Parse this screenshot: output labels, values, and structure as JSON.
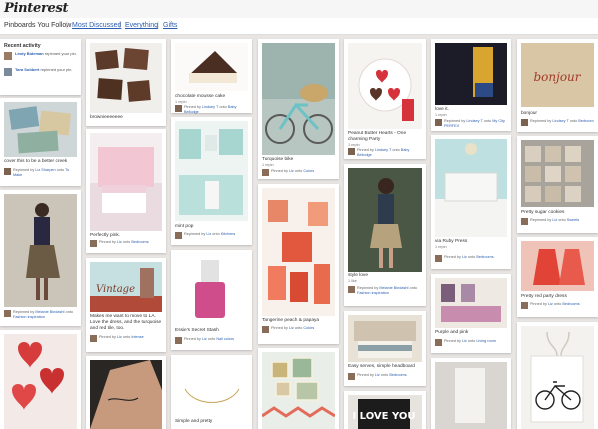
{
  "app": {
    "logo": "Pinterest"
  },
  "nav": {
    "current": "Pinboards You Follow",
    "items": [
      "Most Discussed",
      "Everything",
      "Gifts"
    ],
    "sep": "|"
  },
  "activity": {
    "title": "Recent activity",
    "items": [
      {
        "user": "Lindy Bideman",
        "text": "repinned your pin."
      },
      {
        "user": "Tara Subbert",
        "text": "repinned your pin."
      }
    ]
  },
  "pins": {
    "c0": [
      {
        "desc": "cover this to be a better creek",
        "via_pre": "Repinned by ",
        "by": "Liz Sharpen",
        "via_mid": " onto ",
        "board": "To Make"
      },
      {
        "desc": "",
        "via_pre": "Repinned by ",
        "by": "Melanie Bindasht",
        "via_mid": " onto ",
        "board": "Fashion inspiration"
      }
    ],
    "c1": [
      {
        "desc": "brownieeeeeee",
        "via_pre": "Pinned by ",
        "by": "Lindsey T",
        "via_mid": " onto ",
        "board": "Baby Bellodge"
      },
      {
        "desc": "Perfectly pink.",
        "via_pre": "Pinned by ",
        "by": "Liz",
        "via_mid": " onto ",
        "board": "Bedrooms"
      },
      {
        "desc": "Makes me want to move to LA. Love the dress, and the turquoise and red tile, too.",
        "via_pre": "Pinned by ",
        "by": "Liz",
        "via_mid": " onto ",
        "board": "Intense"
      }
    ],
    "c2": [
      {
        "desc": "chocolate mousse cake",
        "meta": "1 repin",
        "via_pre": "Pinned by ",
        "by": "Lindsey T",
        "via_mid": " onto ",
        "board": "Baby Bellodge"
      },
      {
        "desc": "mint pop",
        "via_pre": "Repinned by ",
        "by": "Liz",
        "via_mid": " onto ",
        "board": "Kitchens"
      },
      {
        "desc": "Essie's Secret Stash",
        "via_pre": "Pinned by ",
        "by": "Liz",
        "via_mid": " onto ",
        "board": "Nail colors"
      },
      {
        "desc": "Simple and pretty",
        "via_pre": "",
        "by": "",
        "via_mid": "",
        "board": ""
      }
    ],
    "c3": [
      {
        "desc": "Turquoise bike",
        "meta": "1 repin",
        "via_pre": "Pinned by ",
        "by": "Liz",
        "via_mid": " onto ",
        "board": "Colors"
      },
      {
        "desc": "Tangerine peach & papaya",
        "via_pre": "Pinned by ",
        "by": "Liz",
        "via_mid": " onto ",
        "board": "Colors"
      }
    ],
    "c4": [
      {
        "desc": "Peanut Butter Hearts - One charming Party",
        "meta": "1 repin",
        "via_pre": "Pinned by ",
        "by": "Lindsey T",
        "via_mid": " onto ",
        "board": "Baby Bellodge"
      },
      {
        "desc": "style love",
        "meta": "1 like",
        "via_pre": "Repinned by ",
        "by": "Melanie Bindasht",
        "via_mid": " onto ",
        "board": "Fashion inspiration"
      },
      {
        "desc": "Easy serves, simple headboard",
        "via_pre": "Pinned by ",
        "by": "Liz",
        "via_mid": " onto ",
        "board": "Bedrooms"
      },
      {
        "desc": "I LOVE YOU",
        "via_pre": "",
        "by": "",
        "via_mid": "",
        "board": ""
      }
    ],
    "c5": [
      {
        "desc": "love it.",
        "meta": "1 repin",
        "via_pre": "Repinned by ",
        "by": "Lindsey T",
        "via_mid": " onto ",
        "board": "My City PERFEX"
      },
      {
        "desc": "via Ruby Press",
        "meta": "1 repin",
        "via_pre": "Pinned by ",
        "by": "Liz",
        "via_mid": " onto ",
        "board": "Bedrooms"
      },
      {
        "desc": "Purple and pink",
        "via_pre": "Pinned by ",
        "by": "Liz",
        "via_mid": " onto ",
        "board": "Living room"
      }
    ],
    "c6": [
      {
        "desc": "bonjour",
        "via_pre": "Repinned by ",
        "by": "Lindsey T",
        "via_mid": " onto ",
        "board": "Bedroom"
      },
      {
        "desc": "Pretty sugar cookies",
        "via_pre": "Repinned by ",
        "by": "Liz",
        "via_mid": " onto ",
        "board": "Sweets"
      },
      {
        "desc": "Pretty red party dress",
        "via_pre": "Pinned by ",
        "by": "Liz",
        "via_mid": " onto ",
        "board": "Bedrooms"
      }
    ]
  },
  "image_text": {
    "bonjour": "bonjour",
    "vintage": "Vintage",
    "iloveyou": "I LOVE YOU"
  },
  "colors": {
    "link": "#2c5fb0",
    "background": "#e8e5e3"
  }
}
